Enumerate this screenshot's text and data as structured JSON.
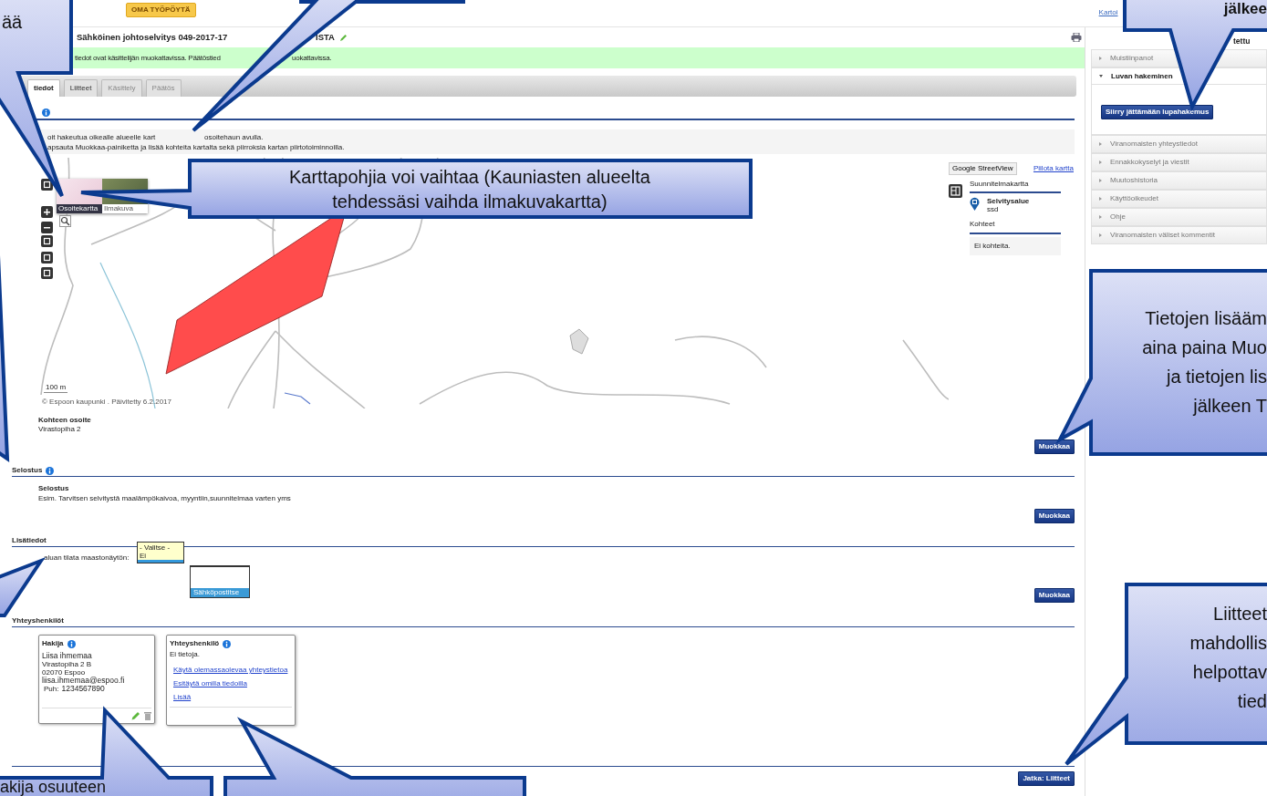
{
  "header": {
    "home_button": "OMA TYÖPÖYTÄ",
    "top_link": "Kartoi"
  },
  "title": {
    "parts": [
      "Sähköinen johtoselvitys 049-2017-17",
      "ISTA"
    ]
  },
  "notice": {
    "parts": [
      "tiedot ovat käsittelijän muokattavissa. Päätöstied",
      "uokattavissa."
    ]
  },
  "tabs": [
    {
      "label": "tiedot",
      "selected": true
    },
    {
      "label": "Liitteet",
      "selected": false
    },
    {
      "label": "Käsittely",
      "selected": false
    },
    {
      "label": "Päätös",
      "selected": false
    }
  ],
  "help_lines": [
    [
      "oit hakeutua oikealle alueelle kart",
      "osoitehaun avulla."
    ],
    [
      "apsauta Muokkaa-painiketta ja lisää kohteita kartalta sekä piirroksia kartan piirtotoiminnoilla."
    ]
  ],
  "map": {
    "layers": [
      {
        "label": "Osoitekartta",
        "selected": true
      },
      {
        "label": "Ilmakuva",
        "selected": false
      }
    ],
    "scale": "100 m",
    "attribution": "© Espoon kaupunki . Päivitetty 6.2.2017",
    "streetview_button": "Google StreetView",
    "hide_link": "Piilota kartta",
    "plan_title": "Suunnitelmakartta",
    "legend_title": "Selvitysalue",
    "legend_subtitle": "ssd",
    "targets_title": "Kohteet",
    "targets_empty": "Ei kohteita."
  },
  "address": {
    "label": "Kohteen osoite",
    "value": "Virastopiha 2",
    "edit_button": "Muokkaa"
  },
  "description": {
    "heading": "Selostus",
    "label": "Selostus",
    "value": "Esim. Tarvitsen selvitystä maalämpökaivoa, myyntiin,suunnitelmaa varten yms",
    "edit_button": "Muokkaa"
  },
  "additional": {
    "heading": "Lisätiedot",
    "field_label": "aluan tilata maastonäytön:",
    "options": [
      "- Valitse -",
      "Ei"
    ],
    "second_list_option": "Sähköpostitse",
    "edit_button": "Muokkaa"
  },
  "contacts": {
    "heading": "Yhteyshenkilöt",
    "applicant": {
      "title": "Hakija",
      "name": "Liisa ihmemaa",
      "street": "Virastopiha 2 B",
      "city": "02070 Espoo",
      "email": "liisa.ihmemaa@espoo.fi",
      "phone_label": "Puh:",
      "phone": "1234567890"
    },
    "contact": {
      "title": "Yhteyshenkilö",
      "empty": "Ei tietoja.",
      "links": [
        "Käytä olemassaolevaa yhteystietoa",
        "Esitäytä omilla tiedoilla",
        "Lisää"
      ]
    }
  },
  "continue_button": "Jatka: Liitteet",
  "sidebar": {
    "header": "tettu",
    "items": [
      {
        "label": "Muistiinpanot",
        "expanded": false
      },
      {
        "label": "Luvan hakeminen",
        "expanded": true,
        "button": "Siirry jättämään lupahakemus"
      },
      {
        "label": "Viranomaisten yhteystiedot",
        "expanded": false
      },
      {
        "label": "Ennakkokyselyt ja viestit",
        "expanded": false
      },
      {
        "label": "Muutoshistoria",
        "expanded": false
      },
      {
        "label": "Käyttöoikeudet",
        "expanded": false
      },
      {
        "label": "Ohje",
        "expanded": false
      },
      {
        "label": "Viranomaisten väliset kommentit",
        "expanded": false
      }
    ]
  },
  "callouts": [
    {
      "lines": [
        "ää"
      ]
    },
    {
      "lines": [
        "Karttapohjia voi vaihtaa (Kauniasten alueelta",
        "tehdessäsi vaihda ilmakuvakartta)"
      ]
    },
    {
      "lines": [
        "jälkee"
      ]
    },
    {
      "lines": [
        "Tietojen lisääm",
        "aina paina Muo",
        "ja tietojen lis",
        "jälkeen T"
      ]
    },
    {
      "lines": [
        "Liitteet",
        "mahdollis",
        "helpottav",
        "tied"
      ]
    },
    {
      "lines": [
        "akija osuuteen"
      ]
    }
  ]
}
